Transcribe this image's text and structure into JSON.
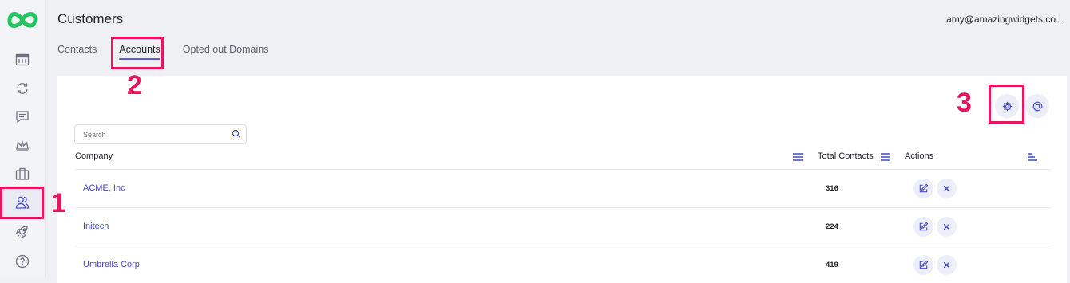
{
  "app": {
    "title": "Customers",
    "user_email": "amy@amazingwidgets.co..."
  },
  "sidebar": {
    "items": [
      {
        "name": "calendar-icon"
      },
      {
        "name": "sync-icon"
      },
      {
        "name": "chat-icon"
      },
      {
        "name": "crown-icon"
      },
      {
        "name": "briefcase-icon"
      },
      {
        "name": "users-icon",
        "active": true
      },
      {
        "name": "rocket-icon"
      },
      {
        "name": "help-icon"
      }
    ]
  },
  "tabs": [
    {
      "label": "Contacts"
    },
    {
      "label": "Accounts",
      "active": true
    },
    {
      "label": "Opted out Domains"
    }
  ],
  "toolbar": {
    "settings_icon": "gear-icon",
    "email_icon": "at-sign-icon"
  },
  "search": {
    "placeholder": "Search",
    "value": ""
  },
  "table": {
    "headers": {
      "company": "Company",
      "total_contacts": "Total Contacts",
      "actions": "Actions"
    },
    "rows": [
      {
        "company": "ACME, Inc",
        "total_contacts": "316"
      },
      {
        "company": "Initech",
        "total_contacts": "224"
      },
      {
        "company": "Umbrella Corp",
        "total_contacts": "419"
      }
    ]
  },
  "annotations": [
    {
      "label": "1"
    },
    {
      "label": "2"
    },
    {
      "label": "3"
    }
  ],
  "colors": {
    "accent": "#5b5fd6",
    "link": "#4448c6",
    "annotation": "#e8175d",
    "logo": "#22c55e",
    "background": "#eef0f4"
  }
}
